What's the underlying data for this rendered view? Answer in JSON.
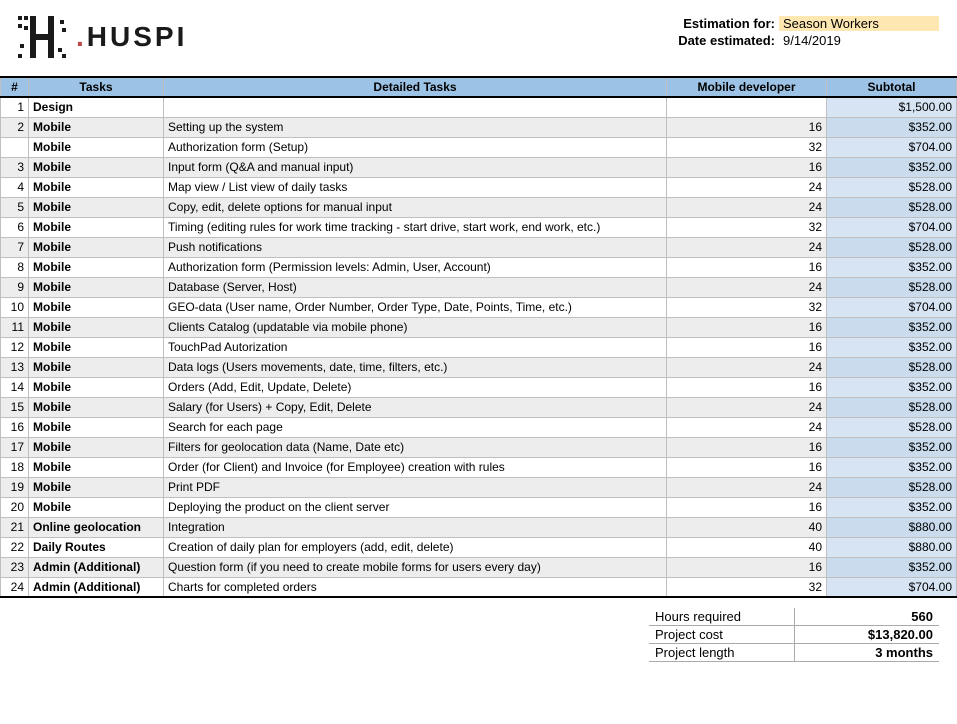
{
  "logo_text": "HUSPI",
  "meta": {
    "estimation_label": "Estimation for:",
    "estimation_value": "Season Workers",
    "date_label": "Date estimated:",
    "date_value": "9/14/2019"
  },
  "headers": {
    "num": "#",
    "tasks": "Tasks",
    "detail": "Detailed Tasks",
    "dev": "Mobile developer",
    "sub": "Subtotal"
  },
  "rows": [
    {
      "num": "1",
      "task": "Design",
      "detail": "",
      "dev": "",
      "sub": "$1,500.00"
    },
    {
      "num": "2",
      "task": "Mobile",
      "detail": "Setting up the system",
      "dev": "16",
      "sub": "$352.00"
    },
    {
      "num": "",
      "task": "Mobile",
      "detail": "Authorization form (Setup)",
      "dev": "32",
      "sub": "$704.00"
    },
    {
      "num": "3",
      "task": "Mobile",
      "detail": "Input form (Q&A and manual input)",
      "dev": "16",
      "sub": "$352.00"
    },
    {
      "num": "4",
      "task": "Mobile",
      "detail": "Map view / List view of daily tasks",
      "dev": "24",
      "sub": "$528.00"
    },
    {
      "num": "5",
      "task": "Mobile",
      "detail": "Copy, edit, delete options for manual input",
      "dev": "24",
      "sub": "$528.00"
    },
    {
      "num": "6",
      "task": "Mobile",
      "detail": "Timing (editing rules for work time tracking - start drive, start work, end work, etc.)",
      "dev": "32",
      "sub": "$704.00"
    },
    {
      "num": "7",
      "task": "Mobile",
      "detail": "Push notifications",
      "dev": "24",
      "sub": "$528.00"
    },
    {
      "num": "8",
      "task": "Mobile",
      "detail": "Authorization form (Permission levels: Admin, User, Account)",
      "dev": "16",
      "sub": "$352.00"
    },
    {
      "num": "9",
      "task": "Mobile",
      "detail": "Database (Server, Host)",
      "dev": "24",
      "sub": "$528.00"
    },
    {
      "num": "10",
      "task": "Mobile",
      "detail": "GEO-data (User name, Order Number, Order Type, Date, Points, Time, etc.)",
      "dev": "32",
      "sub": "$704.00"
    },
    {
      "num": "11",
      "task": "Mobile",
      "detail": "Clients Catalog (updatable via mobile phone)",
      "dev": "16",
      "sub": "$352.00"
    },
    {
      "num": "12",
      "task": "Mobile",
      "detail": "TouchPad Autorization",
      "dev": "16",
      "sub": "$352.00"
    },
    {
      "num": "13",
      "task": "Mobile",
      "detail": "Data logs (Users movements, date, time, filters, etc.)",
      "dev": "24",
      "sub": "$528.00"
    },
    {
      "num": "14",
      "task": "Mobile",
      "detail": "Orders (Add, Edit, Update, Delete)",
      "dev": "16",
      "sub": "$352.00"
    },
    {
      "num": "15",
      "task": "Mobile",
      "detail": "Salary (for Users) + Copy, Edit, Delete",
      "dev": "24",
      "sub": "$528.00"
    },
    {
      "num": "16",
      "task": "Mobile",
      "detail": "Search for each page",
      "dev": "24",
      "sub": "$528.00"
    },
    {
      "num": "17",
      "task": "Mobile",
      "detail": "Filters for geolocation data (Name, Date etc)",
      "dev": "16",
      "sub": "$352.00"
    },
    {
      "num": "18",
      "task": "Mobile",
      "detail": "Order (for Client) and Invoice (for Employee) creation with rules",
      "dev": "16",
      "sub": "$352.00"
    },
    {
      "num": "19",
      "task": "Mobile",
      "detail": "Print PDF",
      "dev": "24",
      "sub": "$528.00"
    },
    {
      "num": "20",
      "task": "Mobile",
      "detail": "Deploying the product on the client server",
      "dev": "16",
      "sub": "$352.00"
    },
    {
      "num": "21",
      "task": "Online geolocation",
      "detail": "Integration",
      "dev": "40",
      "sub": "$880.00"
    },
    {
      "num": "22",
      "task": "Daily Routes",
      "detail": "Creation of daily plan for employers (add, edit, delete)",
      "dev": "40",
      "sub": "$880.00"
    },
    {
      "num": "23",
      "task": "Admin (Additional)",
      "detail": "Question form (if you need to create mobile forms for users every day)",
      "dev": "16",
      "sub": "$352.00"
    },
    {
      "num": "24",
      "task": "Admin (Additional)",
      "detail": "Charts for completed orders",
      "dev": "32",
      "sub": "$704.00"
    }
  ],
  "summary": {
    "hours_label": "Hours required",
    "hours_value": "560",
    "cost_label": "Project cost",
    "cost_value": "$13,820.00",
    "length_label": "Project length",
    "length_value": "3 months"
  }
}
